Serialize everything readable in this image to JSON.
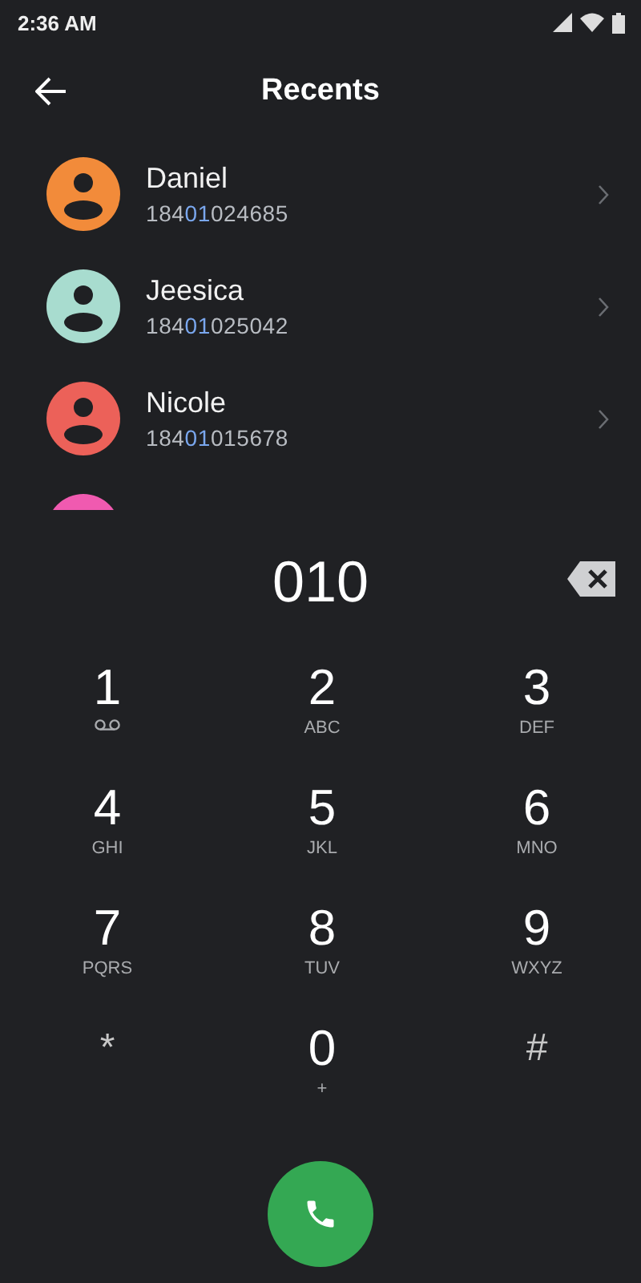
{
  "status_bar": {
    "time": "2:36 AM"
  },
  "header": {
    "title": "Recents"
  },
  "contacts": [
    {
      "name": "Daniel",
      "number": [
        "184",
        "01",
        "024685"
      ],
      "color": "#f28b3a"
    },
    {
      "name": "Jeesica",
      "number": [
        "184",
        "01",
        "025042"
      ],
      "color": "#a8dccf"
    },
    {
      "name": "Nicole",
      "number": [
        "184",
        "01",
        "015678"
      ],
      "color": "#ec6159"
    },
    {
      "color": "#f05ab0"
    }
  ],
  "dialed": "010",
  "keys": [
    {
      "digit": "1",
      "kind": "voicemail"
    },
    {
      "digit": "2",
      "kind": "letters",
      "sub": "ABC"
    },
    {
      "digit": "3",
      "kind": "letters",
      "sub": "DEF"
    },
    {
      "digit": "4",
      "kind": "letters",
      "sub": "GHI"
    },
    {
      "digit": "5",
      "kind": "letters",
      "sub": "JKL"
    },
    {
      "digit": "6",
      "kind": "letters",
      "sub": "MNO"
    },
    {
      "digit": "7",
      "kind": "letters",
      "sub": "PQRS"
    },
    {
      "digit": "8",
      "kind": "letters",
      "sub": "TUV"
    },
    {
      "digit": "9",
      "kind": "letters",
      "sub": "WXYZ"
    },
    {
      "digit": "*",
      "kind": "symbol"
    },
    {
      "digit": "0",
      "kind": "letters",
      "sub": "+"
    },
    {
      "digit": "#",
      "kind": "symbol"
    }
  ]
}
